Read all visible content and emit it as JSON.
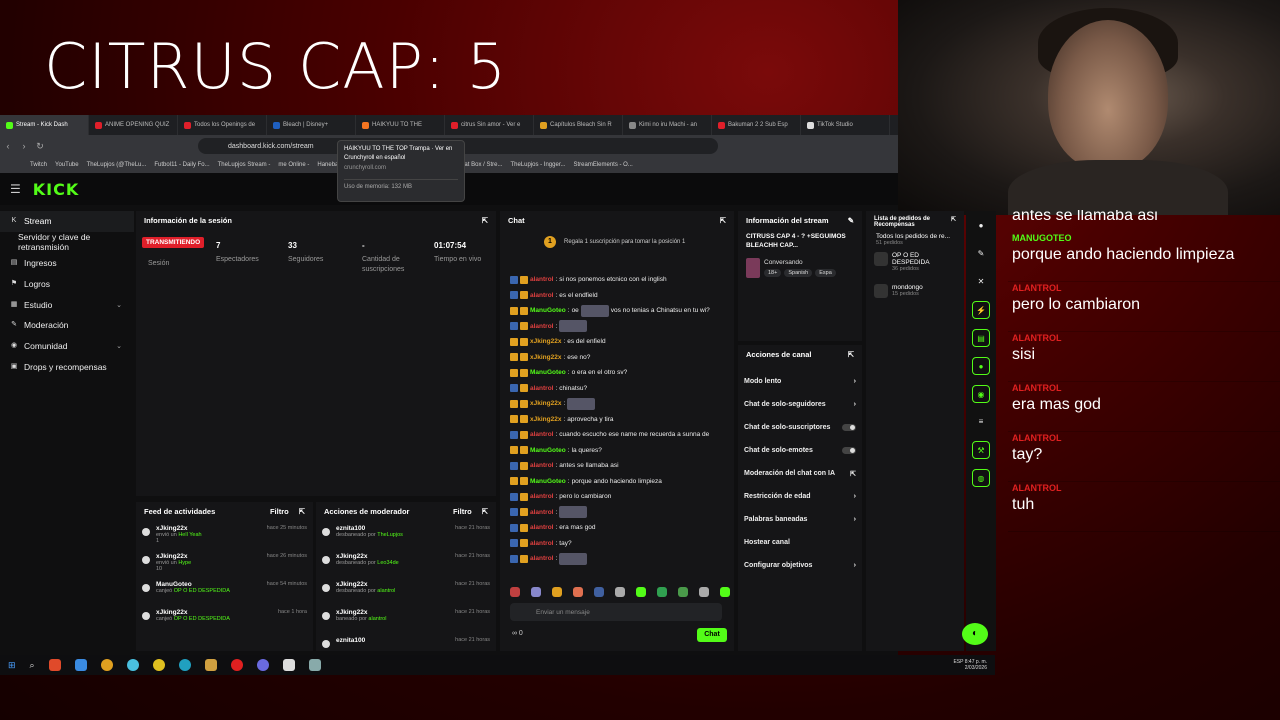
{
  "overlay_title": "CITRUS CAP: 5",
  "browser": {
    "tabs": [
      {
        "label": "Stream - Kick Dash",
        "color": "#53fc18",
        "active": true
      },
      {
        "label": "ANIME OPENING QUIZ",
        "color": "#e01f2a"
      },
      {
        "label": "Todos los Openings de",
        "color": "#e01f2a"
      },
      {
        "label": "Bleach | Disney+",
        "color": "#1f5fbf"
      },
      {
        "label": "HAIKYUU TO THE",
        "color": "#f47521"
      },
      {
        "label": "citrus Sin amor - Ver e",
        "color": "#e01f2a"
      },
      {
        "label": "Capítulos Bleach Sin R",
        "color": "#e0a020"
      },
      {
        "label": "Kimi no iru Machi - an",
        "color": "#888888"
      },
      {
        "label": "Bakuman 2 2 Sub Esp",
        "color": "#e01f2a"
      },
      {
        "label": "TikTok Studio",
        "color": "#dddddd"
      }
    ],
    "url": "dashboard.kick.com/stream",
    "bookmarks": [
      "Twitch",
      "YouTube",
      "TheLupjos (@TheLu...",
      "Futbol11 - Daily Fo...",
      "TheLupjos Stream -",
      "me Online -",
      "Hanebadol - anime...",
      "Haritsu x Itash - anu...",
      "(9) Chat Box / Stre...",
      "TheLupjos - Ingger...",
      "StreamElements - O..."
    ],
    "tooltip": {
      "title": "HAIKYUU TO THE TOP Trampa · Ver en Crunchyroll en español",
      "domain": "crunchyroll.com",
      "memory": "Uso de memoria: 132 MB"
    }
  },
  "kick": {
    "logo": "KICK",
    "sidebar": [
      {
        "label": "Stream",
        "icon": "K",
        "active": true
      },
      {
        "label": "Servidor y clave de retransmisión",
        "icon": "",
        "active": false
      },
      {
        "label": "Ingresos",
        "icon": "▤",
        "active": false
      },
      {
        "label": "Logros",
        "icon": "⚑",
        "active": false
      },
      {
        "label": "Estudio",
        "icon": "▦",
        "active": false,
        "chev": "⌄"
      },
      {
        "label": "Moderación",
        "icon": "✎",
        "active": false
      },
      {
        "label": "Comunidad",
        "icon": "◉",
        "active": false,
        "chev": "⌄"
      },
      {
        "label": "Drops y recompensas",
        "icon": "▣",
        "active": false
      }
    ],
    "session": {
      "title": "Información de la sesión",
      "badge": "TRANSMITIENDO",
      "badge_sub": "Sesión",
      "stats": [
        {
          "value": "7",
          "label": "Espectadores"
        },
        {
          "value": "33",
          "label": "Seguidores"
        },
        {
          "value": "-",
          "label": "Cantidad de suscripciones"
        },
        {
          "value": "01:07:54",
          "label": "Tiempo en vivo"
        }
      ]
    },
    "chat": {
      "title": "Chat",
      "pinned": "Regala 1 suscripción para tomar la posición 1",
      "pinned_num": "1",
      "messages": [
        {
          "user": "alantrol",
          "color": "#e04040",
          "text": "si nos ponemos etcnico con el inglish",
          "badge": "b"
        },
        {
          "user": "alantrol",
          "color": "#e04040",
          "text": "es el endfield",
          "badge": "b"
        },
        {
          "user": "ManuGoteo",
          "color": "#53fc18",
          "text": "oe",
          "emote": true,
          "after": "vos no tenias a Chinatsu en tu wi?",
          "badge": "y"
        },
        {
          "user": "alantrol",
          "color": "#e04040",
          "text": "",
          "emote": true,
          "badge": "b"
        },
        {
          "user": "xJking22x",
          "color": "#e0a020",
          "text": "es del enfield",
          "badge": "y"
        },
        {
          "user": "xJking22x",
          "color": "#e0a020",
          "text": "ese no?",
          "badge": "y"
        },
        {
          "user": "ManuGoteo",
          "color": "#53fc18",
          "text": "o era en el otro sv?",
          "badge": "y"
        },
        {
          "user": "alantrol",
          "color": "#e04040",
          "text": "chinatsu?",
          "badge": "b"
        },
        {
          "user": "xJking22x",
          "color": "#e0a020",
          "text": "",
          "emote": true,
          "badge": "y"
        },
        {
          "user": "xJking22x",
          "color": "#e0a020",
          "text": "aprovecha y tira",
          "badge": "y"
        },
        {
          "user": "alantrol",
          "color": "#e04040",
          "text": "cuando escucho ese name me recuerda a sunna de",
          "badge": "b"
        },
        {
          "user": "ManuGoteo",
          "color": "#53fc18",
          "text": "la queres?",
          "badge": "y"
        },
        {
          "user": "alantrol",
          "color": "#e04040",
          "text": "antes se llamaba asi",
          "badge": "b"
        },
        {
          "user": "ManuGoteo",
          "color": "#53fc18",
          "text": "porque ando haciendo limpieza",
          "badge": "y"
        },
        {
          "user": "alantrol",
          "color": "#e04040",
          "text": "pero lo cambiaron",
          "badge": "b"
        },
        {
          "user": "alantrol",
          "color": "#e04040",
          "text": "",
          "emote": true,
          "badge": "b"
        },
        {
          "user": "alantrol",
          "color": "#e04040",
          "text": "era mas god",
          "badge": "b"
        },
        {
          "user": "alantrol",
          "color": "#e04040",
          "text": "tay?",
          "badge": "b"
        },
        {
          "user": "alantrol",
          "color": "#e04040",
          "text": "",
          "emote": true,
          "badge": "b"
        }
      ],
      "input_placeholder": "Enviar un mensaje",
      "footer": "∞   0",
      "send": "Chat"
    },
    "stream_info": {
      "title": "Información del stream",
      "stream_title": "CITRUSS CAP 4 - ? +SEGUIMOS BLEACHH CAP...",
      "category": "Conversando",
      "tags": [
        "18+",
        "Spanish",
        "Espa"
      ]
    },
    "channel_actions": {
      "title": "Acciones de canal",
      "items": [
        {
          "label": "Modo lento",
          "type": "chev"
        },
        {
          "label": "Chat de solo-seguidores",
          "type": "chev"
        },
        {
          "label": "Chat de solo-suscriptores",
          "type": "toggle"
        },
        {
          "label": "Chat de solo-emotes",
          "type": "toggle"
        },
        {
          "label": "Moderación del chat con IA",
          "type": "link"
        },
        {
          "label": "Restricción de edad",
          "type": "chev"
        },
        {
          "label": "Palabras baneadas",
          "type": "chev"
        },
        {
          "label": "Hostear canal",
          "type": "none"
        },
        {
          "label": "Configurar objetivos",
          "type": "chev"
        }
      ]
    },
    "rewards": {
      "title": "Lista de pedidos de Recompensas",
      "subtitle": "Todos los pedidos de re...",
      "count": "51 pedidos",
      "items": [
        {
          "name": "OP O ED DESPEDIDA",
          "count": "36 pedidos"
        },
        {
          "name": "mondongo",
          "count": "15 pedidos"
        }
      ]
    },
    "feed": {
      "title": "Feed de actividades",
      "filter": "Filtro",
      "items": [
        {
          "user": "xJking22x",
          "text": "envió un",
          "hl": "Hell Yeah",
          "extra": "1",
          "time": "hace 25 minutos"
        },
        {
          "user": "xJking22x",
          "text": "envió un",
          "hl": "Hype",
          "extra": "10",
          "time": "hace 26 minutos"
        },
        {
          "user": "ManuGoteo",
          "text": "canjeó",
          "hl": "OP O ED DESPEDIDA",
          "extra": "",
          "time": "hace 54 minutos"
        },
        {
          "user": "xJking22x",
          "text": "canjeó",
          "hl": "OP O ED DESPEDIDA",
          "extra": "",
          "time": "hace 1 hora"
        }
      ]
    },
    "mod": {
      "title": "Acciones de moderador",
      "filter": "Filtro",
      "items": [
        {
          "user": "eznita100",
          "text": "desbaneado por",
          "by": "TheLupjos",
          "time": "hace 21 horas"
        },
        {
          "user": "xJking22x",
          "text": "desbaneado por",
          "by": "Leo34de",
          "time": "hace 21 horas"
        },
        {
          "user": "xJking22x",
          "text": "desbaneado por",
          "by": "alantrol",
          "time": "hace 21 horas"
        },
        {
          "user": "xJking22x",
          "text": "baneado por",
          "by": "alantrol",
          "time": "hace 21 horas"
        },
        {
          "user": "eznita100",
          "text": "",
          "by": "",
          "time": "hace 21 horas"
        }
      ]
    }
  },
  "taskbar": {
    "time": "8:47 p. m.",
    "date": "2/03/2026",
    "lang": "ESP"
  },
  "overlay_chat": {
    "first": "antes se llamaba asi",
    "messages": [
      {
        "user": "MANUGOTEO",
        "color": "#53fc18",
        "text": "porque ando haciendo limpieza"
      },
      {
        "user": "ALANTROL",
        "color": "#e02020",
        "text": "pero lo cambiaron"
      },
      {
        "user": "ALANTROL",
        "color": "#e02020",
        "text": "sisi"
      },
      {
        "user": "ALANTROL",
        "color": "#e02020",
        "text": "era mas god"
      },
      {
        "user": "ALANTROL",
        "color": "#e02020",
        "text": "tay?"
      },
      {
        "user": "ALANTROL",
        "color": "#e02020",
        "text": "tuh"
      }
    ]
  }
}
